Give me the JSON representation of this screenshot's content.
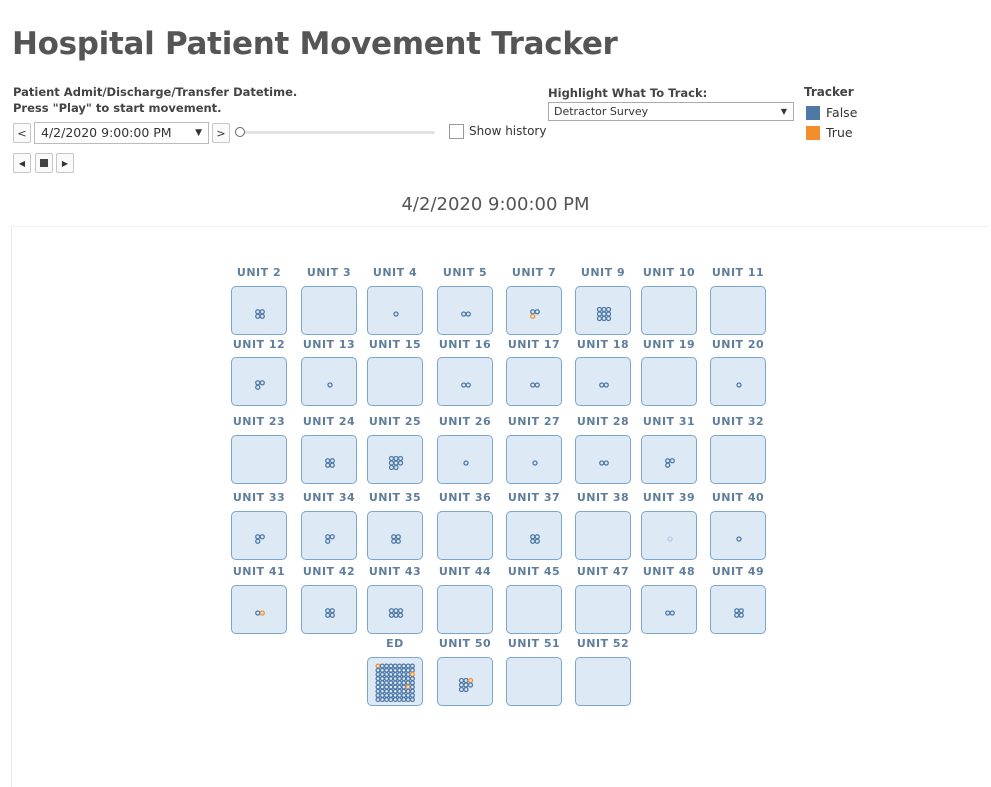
{
  "title": "Hospital Patient Movement Tracker",
  "controls": {
    "admit_label_1": "Patient Admit/Discharge/Transfer Datetime.",
    "admit_label_2": "Press \"Play\" to start movement.",
    "prev": "<",
    "next": ">",
    "date_value": "4/2/2020 9:00:00 PM",
    "show_history": "Show history",
    "slider_position": 0
  },
  "highlight": {
    "label": "Highlight What To Track:",
    "value": "Detractor Survey"
  },
  "legend": {
    "title": "Tracker",
    "items": [
      {
        "label": "False",
        "color": "#4e79a7"
      },
      {
        "label": "True",
        "color": "#f28e2b"
      }
    ]
  },
  "current_time": "4/2/2020 9:00:00 PM",
  "units": [
    {
      "name": "UNIT 2",
      "dots": "4",
      "row": 0,
      "col": 0
    },
    {
      "name": "UNIT 3",
      "dots": "0",
      "row": 0,
      "col": 1
    },
    {
      "name": "UNIT 4",
      "dots": "1",
      "row": 0,
      "col": 2
    },
    {
      "name": "UNIT 5",
      "dots": "2",
      "row": 0,
      "col": 3
    },
    {
      "name": "UNIT 7",
      "dots": "3t",
      "row": 0,
      "col": 4
    },
    {
      "name": "UNIT 9",
      "dots": "9",
      "row": 0,
      "col": 5
    },
    {
      "name": "UNIT 10",
      "dots": "0",
      "row": 0,
      "col": 6
    },
    {
      "name": "UNIT 11",
      "dots": "0",
      "row": 0,
      "col": 7
    },
    {
      "name": "UNIT 12",
      "dots": "3",
      "row": 1,
      "col": 0
    },
    {
      "name": "UNIT 13",
      "dots": "1",
      "row": 1,
      "col": 1
    },
    {
      "name": "UNIT 15",
      "dots": "0",
      "row": 1,
      "col": 2
    },
    {
      "name": "UNIT 16",
      "dots": "2",
      "row": 1,
      "col": 3
    },
    {
      "name": "UNIT 17",
      "dots": "2",
      "row": 1,
      "col": 4
    },
    {
      "name": "UNIT 18",
      "dots": "2",
      "row": 1,
      "col": 5
    },
    {
      "name": "UNIT 19",
      "dots": "0",
      "row": 1,
      "col": 6
    },
    {
      "name": "UNIT 20",
      "dots": "1",
      "row": 1,
      "col": 7
    },
    {
      "name": "UNIT 23",
      "dots": "0",
      "row": 2,
      "col": 0
    },
    {
      "name": "UNIT 24",
      "dots": "4",
      "row": 2,
      "col": 1
    },
    {
      "name": "UNIT 25",
      "dots": "8",
      "row": 2,
      "col": 2
    },
    {
      "name": "UNIT 26",
      "dots": "1",
      "row": 2,
      "col": 3
    },
    {
      "name": "UNIT 27",
      "dots": "1",
      "row": 2,
      "col": 4
    },
    {
      "name": "UNIT 28",
      "dots": "2",
      "row": 2,
      "col": 5
    },
    {
      "name": "UNIT 31",
      "dots": "3",
      "row": 2,
      "col": 6
    },
    {
      "name": "UNIT 32",
      "dots": "0",
      "row": 2,
      "col": 7
    },
    {
      "name": "UNIT 33",
      "dots": "3",
      "row": 3,
      "col": 0
    },
    {
      "name": "UNIT 34",
      "dots": "3",
      "row": 3,
      "col": 1
    },
    {
      "name": "UNIT 35",
      "dots": "4",
      "row": 3,
      "col": 2
    },
    {
      "name": "UNIT 36",
      "dots": "0",
      "row": 3,
      "col": 3
    },
    {
      "name": "UNIT 37",
      "dots": "4",
      "row": 3,
      "col": 4
    },
    {
      "name": "UNIT 38",
      "dots": "0",
      "row": 3,
      "col": 5
    },
    {
      "name": "UNIT 39",
      "dots": "1f",
      "row": 3,
      "col": 6
    },
    {
      "name": "UNIT 40",
      "dots": "1",
      "row": 3,
      "col": 7
    },
    {
      "name": "UNIT 41",
      "dots": "2t",
      "row": 4,
      "col": 0
    },
    {
      "name": "UNIT 42",
      "dots": "4",
      "row": 4,
      "col": 1
    },
    {
      "name": "UNIT 43",
      "dots": "6",
      "row": 4,
      "col": 2
    },
    {
      "name": "UNIT 44",
      "dots": "0",
      "row": 4,
      "col": 3
    },
    {
      "name": "UNIT 45",
      "dots": "0",
      "row": 4,
      "col": 4
    },
    {
      "name": "UNIT 47",
      "dots": "0",
      "row": 4,
      "col": 5
    },
    {
      "name": "UNIT 48",
      "dots": "2",
      "row": 4,
      "col": 6
    },
    {
      "name": "UNIT 49",
      "dots": "4",
      "row": 4,
      "col": 7
    },
    {
      "name": "ED",
      "dots": "ed",
      "row": 5,
      "col": 2
    },
    {
      "name": "UNIT 50",
      "dots": "8t",
      "row": 5,
      "col": 3
    },
    {
      "name": "UNIT 51",
      "dots": "0",
      "row": 5,
      "col": 4
    },
    {
      "name": "UNIT 52",
      "dots": "0",
      "row": 5,
      "col": 5
    }
  ]
}
